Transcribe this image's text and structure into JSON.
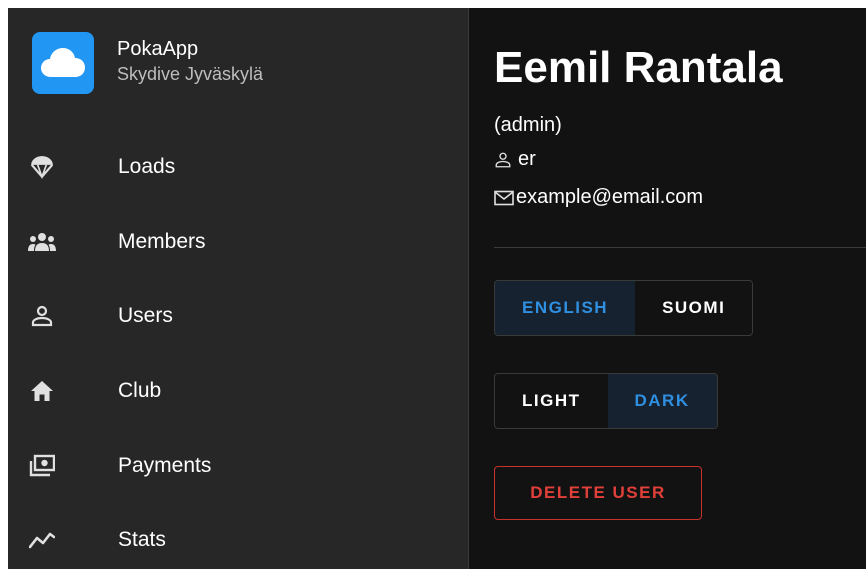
{
  "app": {
    "name": "PokaApp",
    "club": "Skydive Jyväskylä",
    "logo_icon": "cloud-icon",
    "logo_color": "#2196f3"
  },
  "sidebar": {
    "items": [
      {
        "label": "Loads",
        "icon": "parachute-icon"
      },
      {
        "label": "Members",
        "icon": "group-icon"
      },
      {
        "label": "Users",
        "icon": "person-icon"
      },
      {
        "label": "Club",
        "icon": "home-icon"
      },
      {
        "label": "Payments",
        "icon": "payments-icon"
      },
      {
        "label": "Stats",
        "icon": "trending-icon"
      }
    ]
  },
  "profile": {
    "name": "Eemil Rantala",
    "role": "(admin)",
    "username": "er",
    "email": "example@email.com"
  },
  "language": {
    "options": [
      "ENGLISH",
      "SUOMI"
    ],
    "selected": "ENGLISH"
  },
  "theme": {
    "options": [
      "LIGHT",
      "DARK"
    ],
    "selected": "DARK"
  },
  "actions": {
    "delete_label": "DELETE USER"
  },
  "colors": {
    "sidebar_bg": "#272727",
    "main_bg": "#121212",
    "accent": "#2f8fe0",
    "danger": "#e1403a"
  }
}
